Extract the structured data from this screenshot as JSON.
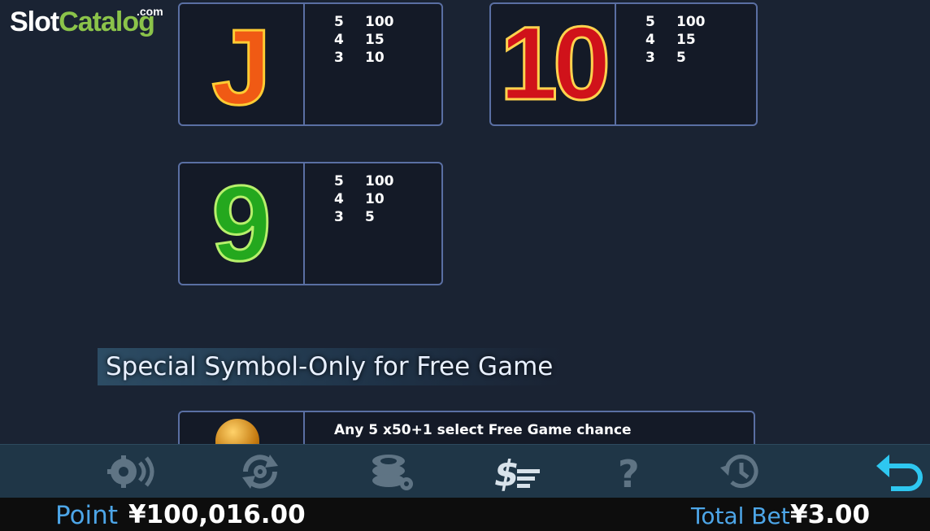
{
  "logo": {
    "part1": "Slot",
    "part2": "Catalog",
    "suffix": ".com"
  },
  "paytable": [
    {
      "symbol": "J",
      "rows": [
        {
          "count": "5",
          "pay": "100"
        },
        {
          "count": "4",
          "pay": "15"
        },
        {
          "count": "3",
          "pay": "10"
        }
      ]
    },
    {
      "symbol": "10",
      "rows": [
        {
          "count": "5",
          "pay": "100"
        },
        {
          "count": "4",
          "pay": "15"
        },
        {
          "count": "3",
          "pay": "5"
        }
      ]
    },
    {
      "symbol": "9",
      "rows": [
        {
          "count": "5",
          "pay": "100"
        },
        {
          "count": "4",
          "pay": "10"
        },
        {
          "count": "3",
          "pay": "5"
        }
      ]
    }
  ],
  "special": {
    "title": "Special Symbol-Only for Free Game",
    "description": "Any 5  x50+1 select Free Game chance"
  },
  "toolbar": {
    "buttons": [
      "sound-settings-icon",
      "autoplay-icon",
      "chips-settings-icon",
      "paytable-icon",
      "help-icon",
      "history-icon",
      "back-icon"
    ]
  },
  "footer": {
    "point_label": "Point",
    "point_value": "¥100,016.00",
    "total_bet_label": "Total Bet",
    "total_bet_value": "¥3.00"
  },
  "colors": {
    "accent_blue": "#4da6e8",
    "active_cyan": "#2ec7f0",
    "card_border": "#5a6fa3"
  }
}
